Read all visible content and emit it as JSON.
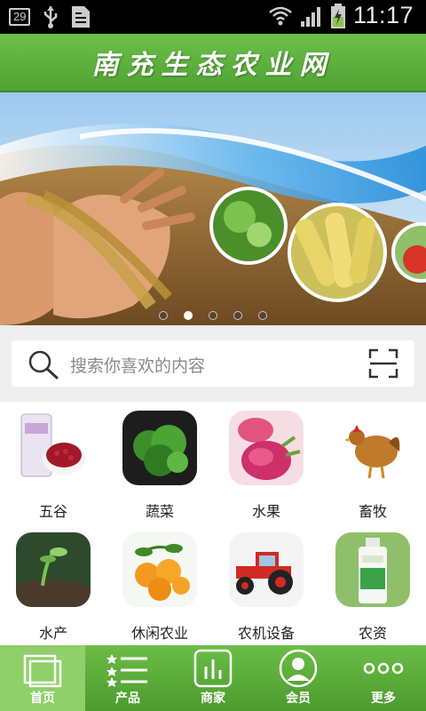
{
  "status_bar": {
    "notification_count": "29",
    "time": "11:17"
  },
  "header": {
    "title": "南充生态农业网"
  },
  "banner": {
    "slide_count": 5,
    "active_slide_index": 1
  },
  "search": {
    "placeholder": "搜索你喜欢的内容"
  },
  "categories": [
    {
      "label": "五谷",
      "icon": "grain-icon"
    },
    {
      "label": "蔬菜",
      "icon": "vegetable-icon"
    },
    {
      "label": "水果",
      "icon": "fruit-icon"
    },
    {
      "label": "畜牧",
      "icon": "livestock-icon"
    },
    {
      "label": "水产",
      "icon": "aquatic-icon"
    },
    {
      "label": "休闲农业",
      "icon": "leisure-agriculture-icon"
    },
    {
      "label": "农机设备",
      "icon": "tractor-icon"
    },
    {
      "label": "农资",
      "icon": "farm-supplies-icon"
    }
  ],
  "tabbar": {
    "items": [
      {
        "label": "首页",
        "icon": "home-icon",
        "active": true
      },
      {
        "label": "产品",
        "icon": "list-icon",
        "active": false
      },
      {
        "label": "商家",
        "icon": "store-chart-icon",
        "active": false
      },
      {
        "label": "会员",
        "icon": "member-icon",
        "active": false
      },
      {
        "label": "更多",
        "icon": "more-dots-icon",
        "active": false
      }
    ]
  },
  "colors": {
    "brand_green": "#4fa332",
    "tab_active": "#8fd06a"
  }
}
